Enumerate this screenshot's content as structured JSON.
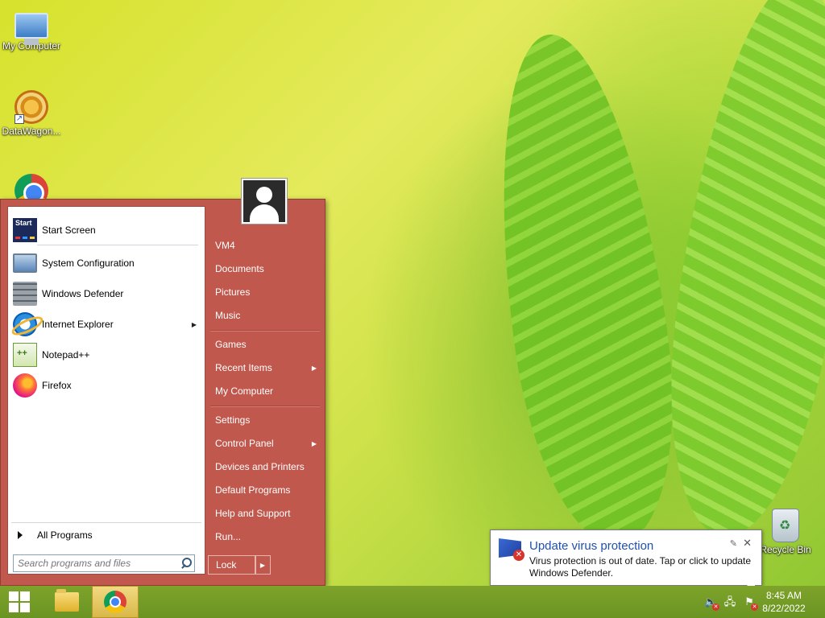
{
  "desktop": {
    "icons": [
      {
        "label": "My Computer",
        "icon": "my-computer-icon"
      },
      {
        "label": "DataWagon...",
        "icon": "datawagon-icon"
      },
      {
        "label": "",
        "icon": "chrome-icon"
      },
      {
        "label": "Recycle Bin",
        "icon": "recycle-bin-icon"
      }
    ]
  },
  "start_menu": {
    "accent_color": "#c1584d",
    "programs": [
      {
        "label": "Start Screen",
        "icon": "start-screen-icon"
      },
      {
        "label": "System Configuration",
        "icon": "system-configuration-icon"
      },
      {
        "label": "Windows Defender",
        "icon": "windows-defender-icon"
      },
      {
        "label": "Internet Explorer",
        "icon": "internet-explorer-icon",
        "has_submenu": true
      },
      {
        "label": "Notepad++",
        "icon": "notepad-plus-plus-icon"
      },
      {
        "label": "Firefox",
        "icon": "firefox-icon"
      }
    ],
    "all_programs_label": "All Programs",
    "search_placeholder": "Search programs and files",
    "right_items": [
      {
        "label": "VM4"
      },
      {
        "label": "Documents"
      },
      {
        "label": "Pictures"
      },
      {
        "label": "Music"
      },
      {
        "label": "Games"
      },
      {
        "label": "Recent Items",
        "has_submenu": true
      },
      {
        "label": "My Computer"
      },
      {
        "label": "Settings"
      },
      {
        "label": "Control Panel",
        "has_submenu": true
      },
      {
        "label": "Devices and Printers"
      },
      {
        "label": "Default Programs"
      },
      {
        "label": "Help and Support"
      },
      {
        "label": "Run..."
      }
    ],
    "lock_label": "Lock"
  },
  "notification": {
    "title": "Update virus protection",
    "body": "Virus protection is out of date. Tap or click to update Windows Defender.",
    "icon": "defender-flag-icon"
  },
  "taskbar": {
    "apps": [
      {
        "name": "file-explorer",
        "icon": "folder-icon"
      },
      {
        "name": "chrome",
        "icon": "chrome-icon",
        "active": true
      }
    ],
    "tray": [
      "volume-muted-icon",
      "network-icon",
      "action-center-alert-icon"
    ],
    "time": "8:45 AM",
    "date": "8/22/2022"
  }
}
